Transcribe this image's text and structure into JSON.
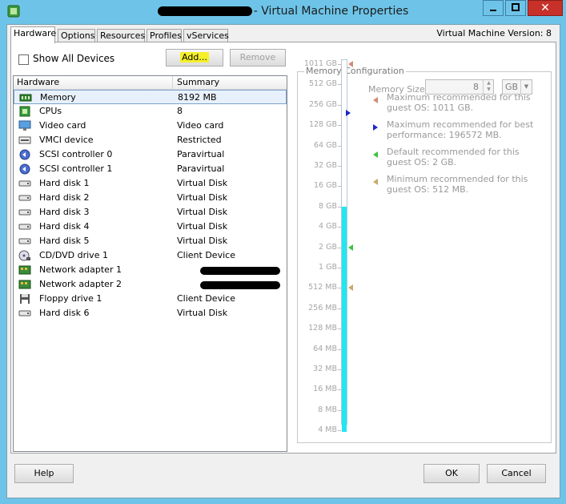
{
  "window": {
    "title_suffix": "- Virtual Machine Properties",
    "vm_version": "Virtual Machine Version: 8"
  },
  "tabs": [
    {
      "label": "Hardware",
      "active": true
    },
    {
      "label": "Options"
    },
    {
      "label": "Resources"
    },
    {
      "label": "Profiles"
    },
    {
      "label": "vServices"
    }
  ],
  "toolbar": {
    "show_all_devices": "Show All Devices",
    "add_label": "Add...",
    "remove_label": "Remove"
  },
  "device_list": {
    "headers": [
      "Hardware",
      "Summary"
    ],
    "rows": [
      {
        "name": "Memory",
        "summary": "8192 MB",
        "icon": "memory-icon",
        "selected": true
      },
      {
        "name": "CPUs",
        "summary": "8",
        "icon": "cpu-icon"
      },
      {
        "name": "Video card",
        "summary": "Video card",
        "icon": "monitor-icon"
      },
      {
        "name": "VMCI device",
        "summary": "Restricted",
        "icon": "vmci-icon"
      },
      {
        "name": "SCSI controller 0",
        "summary": "Paravirtual",
        "icon": "scsi-icon"
      },
      {
        "name": "SCSI controller 1",
        "summary": "Paravirtual",
        "icon": "scsi-icon"
      },
      {
        "name": "Hard disk 1",
        "summary": "Virtual Disk",
        "icon": "harddisk-icon"
      },
      {
        "name": "Hard disk 2",
        "summary": "Virtual Disk",
        "icon": "harddisk-icon"
      },
      {
        "name": "Hard disk 3",
        "summary": "Virtual Disk",
        "icon": "harddisk-icon"
      },
      {
        "name": "Hard disk 4",
        "summary": "Virtual Disk",
        "icon": "harddisk-icon"
      },
      {
        "name": "Hard disk 5",
        "summary": "Virtual Disk",
        "icon": "harddisk-icon"
      },
      {
        "name": "CD/DVD drive 1",
        "summary": "Client Device",
        "icon": "cdrom-icon"
      },
      {
        "name": "Network adapter 1",
        "summary": null,
        "icon": "network-icon"
      },
      {
        "name": "Network adapter 2",
        "summary": null,
        "icon": "network-icon"
      },
      {
        "name": "Floppy drive 1",
        "summary": "Client Device",
        "icon": "floppy-icon"
      },
      {
        "name": "Hard disk 6",
        "summary": "Virtual Disk",
        "icon": "harddisk-icon"
      }
    ]
  },
  "memory": {
    "group_title": "Memory Configuration",
    "size_label": "Memory Size:",
    "size_value": "8",
    "unit": "GB",
    "scale": [
      "1011 GB",
      "512 GB",
      "256 GB",
      "128 GB",
      "64 GB",
      "32 GB",
      "16 GB",
      "8 GB",
      "4 GB",
      "2 GB",
      "1 GB",
      "512 MB",
      "256 MB",
      "128 MB",
      "64 MB",
      "32 MB",
      "16 MB",
      "8 MB",
      "4 MB"
    ],
    "current_level": "8 GB",
    "notes": [
      {
        "text": "Maximum recommended for this guest OS: 1011 GB.",
        "color": "#d48a78",
        "level": "1011 GB"
      },
      {
        "text": "Maximum recommended for best performance: 196572 MB.",
        "color": "#1c27c4",
        "level": "192 GB"
      },
      {
        "text": "Default recommended for this guest OS: 2 GB.",
        "color": "#3ec43e",
        "level": "2 GB"
      },
      {
        "text": "Minimum recommended for this guest OS: 512 MB.",
        "color": "#c9a86a",
        "level": "512 MB"
      }
    ]
  },
  "footer": {
    "help_label": "Help",
    "ok_label": "OK",
    "cancel_label": "Cancel"
  }
}
